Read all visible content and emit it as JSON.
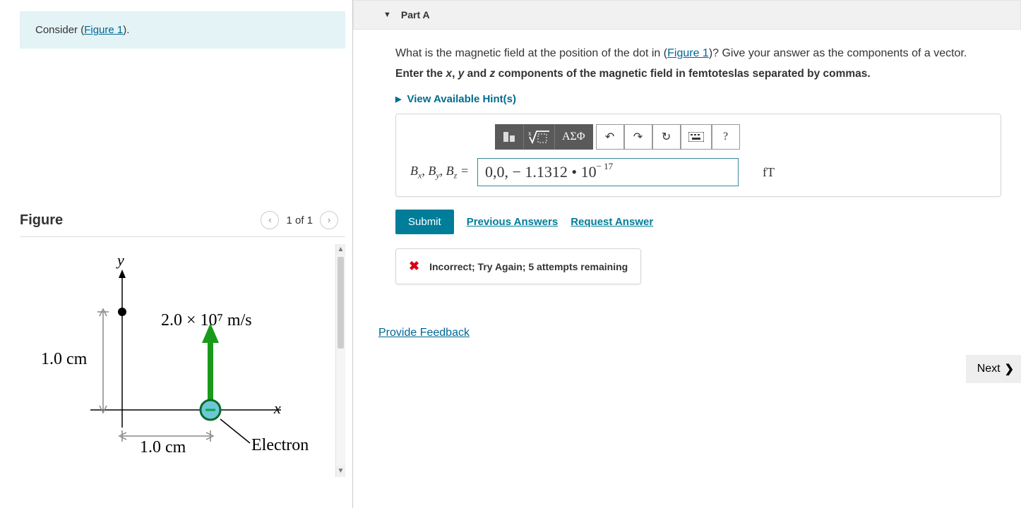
{
  "consider": {
    "prefix": "Consider (",
    "link": "Figure 1",
    "suffix": ")."
  },
  "figure": {
    "title": "Figure",
    "pager": "1 of 1",
    "y_label": "y",
    "x_label": "x",
    "speed": "2.0 × 10⁷ m/s",
    "dist_y": "1.0 cm",
    "dist_x": "1.0 cm",
    "particle": "Electron"
  },
  "part": {
    "label": "Part A"
  },
  "question": {
    "q_before": "What is the magnetic field at the position of the dot in (",
    "q_link": "Figure 1",
    "q_after": ")? Give your answer as the components of a vector.",
    "format_prefix": "Enter the ",
    "var_x": "x",
    "sep1": ", ",
    "var_y": "y",
    "sep2": " and ",
    "var_z": "z",
    "format_suffix": " components of the magnetic field in femtoteslas separated by commas."
  },
  "hints": {
    "label": "View Available Hint(s)"
  },
  "toolbar": {
    "greek": "ΑΣΦ",
    "undo": "↶",
    "redo": "↷",
    "reset": "↻",
    "help": "?"
  },
  "answer": {
    "label_html": "Bₓ, Bᵧ, B_z =",
    "value_main": "0,0, − 1.1312 • 10",
    "value_exp": " − 17",
    "unit": "fT"
  },
  "actions": {
    "submit": "Submit",
    "previous": "Previous Answers",
    "request": "Request Answer"
  },
  "feedback": {
    "text": "Incorrect; Try Again; 5 attempts remaining"
  },
  "footer": {
    "provide": "Provide Feedback",
    "next": "Next"
  }
}
